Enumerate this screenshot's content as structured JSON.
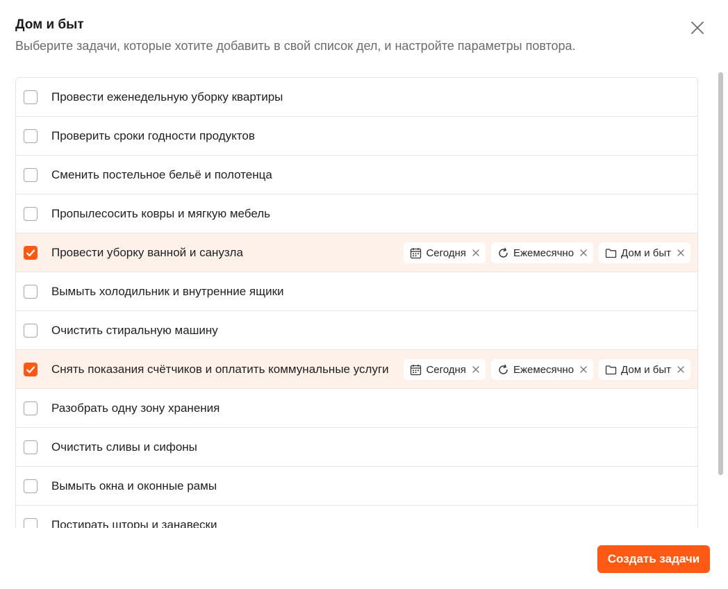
{
  "dialog": {
    "title": "Дом и быт",
    "subtitle": "Выберите задачи, которые хотите добавить в свой список дел, и настройте параметры повтора."
  },
  "tasks": [
    {
      "label": "Провести еженедельную уборку квартиры",
      "checked": false
    },
    {
      "label": "Проверить сроки годности продуктов",
      "checked": false
    },
    {
      "label": "Сменить постельное бельё и полотенца",
      "checked": false
    },
    {
      "label": "Пропылесосить ковры и мягкую мебель",
      "checked": false
    },
    {
      "label": "Провести уборку ванной и санузла",
      "checked": true,
      "date": "Сегодня",
      "repeat": "Ежемесячно",
      "category": "Дом и быт"
    },
    {
      "label": "Вымыть холодильник и внутренние ящики",
      "checked": false
    },
    {
      "label": "Очистить стиральную машину",
      "checked": false
    },
    {
      "label": "Снять показания счётчиков и оплатить коммунальные услуги",
      "checked": true,
      "date": "Сегодня",
      "repeat": "Ежемесячно",
      "category": "Дом и быт"
    },
    {
      "label": "Разобрать одну зону хранения",
      "checked": false
    },
    {
      "label": "Очистить сливы и сифоны",
      "checked": false
    },
    {
      "label": "Вымыть окна и оконные рамы",
      "checked": false
    },
    {
      "label": "Постирать шторы и занавески",
      "checked": false
    }
  ],
  "footer": {
    "submit_label": "Создать задачи"
  },
  "colors": {
    "accent": "#ff5a14",
    "selected_row": "#fdf1e9"
  },
  "icons": {
    "close": "close-icon",
    "checkbox_check": "checkmark-icon",
    "date": "calendar-icon",
    "repeat": "repeat-icon",
    "category": "folder-icon",
    "remove": "remove-x-icon"
  }
}
